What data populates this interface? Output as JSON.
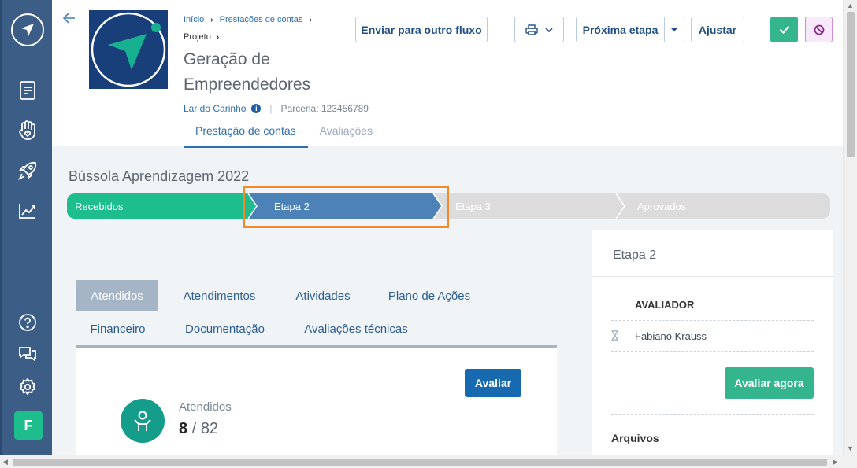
{
  "header": {
    "breadcrumb": [
      "Início",
      "Prestações de contas"
    ],
    "breadcrumb2": "Projeto",
    "title": "Geração de Empreendedores",
    "organization": "Lar do Carinho",
    "partnership": "Parceria: 123456789",
    "tabs": [
      {
        "label": "Prestação de contas",
        "active": true
      },
      {
        "label": "Avaliações",
        "active": false
      }
    ],
    "buttons": {
      "send_flow": "Enviar para outro fluxo",
      "next_step": "Próxima etapa",
      "adjust": "Ajustar"
    }
  },
  "section_title": "Bússola Aprendizagem 2022",
  "stepper": {
    "steps": [
      {
        "label": "Recebidos",
        "state": "done"
      },
      {
        "label": "Etapa 2",
        "state": "current"
      },
      {
        "label": "Etapa 3",
        "state": "pending"
      },
      {
        "label": "Aprovados",
        "state": "pending"
      }
    ],
    "colors": {
      "done": "#1ebd8e",
      "current": "#4d82b8",
      "pending": "#dcdcdc"
    }
  },
  "panel_tabs": [
    {
      "label": "Atendidos",
      "active": true
    },
    {
      "label": "Atendimentos",
      "active": false
    },
    {
      "label": "Atividades",
      "active": false
    },
    {
      "label": "Plano de Ações",
      "active": false
    },
    {
      "label": "Financeiro",
      "active": false
    },
    {
      "label": "Documentação",
      "active": false
    },
    {
      "label": "Avaliações técnicas",
      "active": false
    }
  ],
  "content": {
    "evaluate_button": "Avaliar",
    "stat_label": "Atendidos",
    "stat_value": "8",
    "stat_total": "82"
  },
  "right_panel": {
    "title": "Etapa 2",
    "evaluator_heading": "AVALIADOR",
    "evaluator_name": "Fabiano Krauss",
    "evaluate_now": "Avaliar agora",
    "files_heading": "Arquivos"
  },
  "sidebar": {
    "avatar_letter": "F",
    "icons": [
      "logo-icon",
      "document-icon",
      "hand-heart-icon",
      "rocket-icon",
      "chart-icon",
      "help-icon",
      "chat-icon",
      "gear-icon"
    ]
  }
}
